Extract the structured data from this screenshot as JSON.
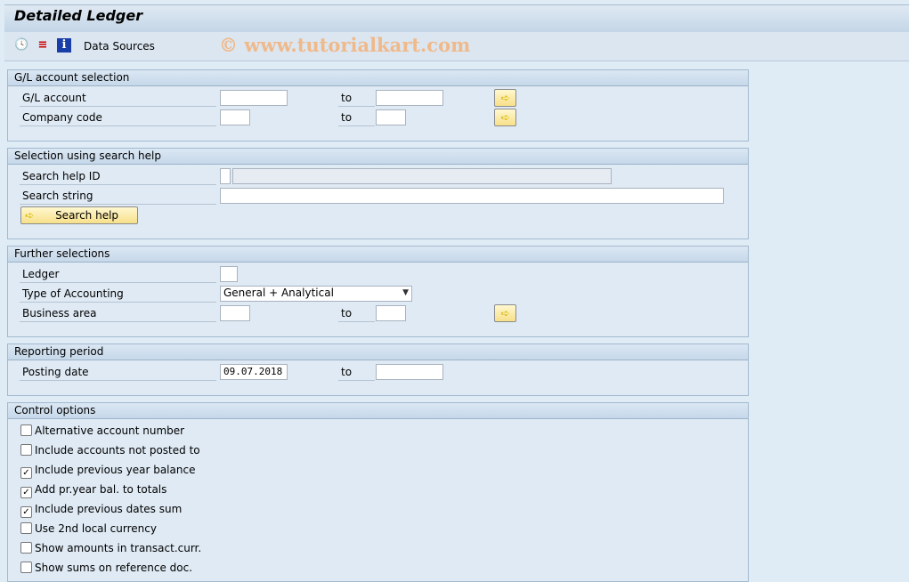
{
  "window": {
    "title": "Detailed Ledger"
  },
  "toolbar": {
    "icons": [
      "execute-clock-icon",
      "selection-options-icon",
      "information-icon"
    ],
    "data_sources": "Data Sources"
  },
  "watermark": "© www.tutorialkart.com",
  "gl_selection": {
    "header": "G/L account selection",
    "gl_account": {
      "label": "G/L account",
      "from": "",
      "to_label": "to",
      "to": ""
    },
    "company_code": {
      "label": "Company code",
      "from": "",
      "to_label": "to",
      "to": ""
    }
  },
  "search_help": {
    "header": "Selection using search help",
    "id_label": "Search help ID",
    "id_value": "",
    "id_desc": "",
    "string_label": "Search string",
    "string_value": "",
    "button": "Search help"
  },
  "further": {
    "header": "Further selections",
    "ledger_label": "Ledger",
    "ledger_value": "",
    "type_label": "Type of Accounting",
    "type_value": "General + Analytical",
    "ba_label": "Business area",
    "ba_from": "",
    "to_label": "to",
    "ba_to": ""
  },
  "reporting": {
    "header": "Reporting period",
    "posting_label": "Posting date",
    "posting_from": "09.07.2018",
    "to_label": "to",
    "posting_to": ""
  },
  "control": {
    "header": "Control options",
    "options": [
      {
        "label": "Alternative account number",
        "checked": false
      },
      {
        "label": "Include accounts not posted to",
        "checked": false
      },
      {
        "label": "Include previous year balance",
        "checked": true
      },
      {
        "label": "Add pr.year bal. to totals",
        "checked": true
      },
      {
        "label": "Include previous dates sum",
        "checked": true
      },
      {
        "label": "Use 2nd local currency",
        "checked": false
      },
      {
        "label": "Show amounts in transact.curr.",
        "checked": false
      },
      {
        "label": "Show sums on reference doc.",
        "checked": false
      }
    ]
  }
}
